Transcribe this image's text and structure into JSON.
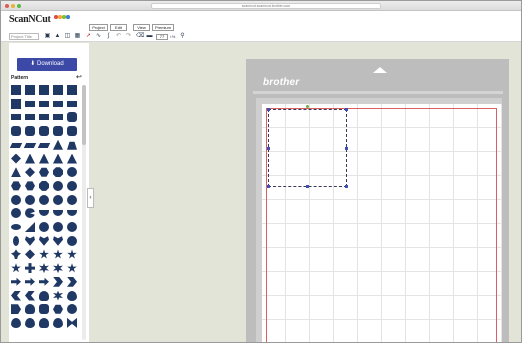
{
  "browser": {
    "url": "scanncut.scanncut.brother.com"
  },
  "header": {
    "logo_text": "ScanNCut",
    "project_placeholder": "Project Title",
    "tabs": [
      "Project",
      "Edit",
      "View",
      "Premium"
    ],
    "zoom_value": "77"
  },
  "toolbar": {
    "icons": [
      "new-project-icon",
      "save-icon",
      "open-icon",
      "cut-settings-icon",
      "select-arrow-icon",
      "curve-tool-icon",
      "bezier-tool-icon",
      "undo-icon",
      "redo-icon",
      "delete-icon",
      "fill-icon",
      "zoom-in-icon"
    ]
  },
  "sidebar": {
    "download_label": "Download",
    "pattern_label": "Pattern",
    "back_symbol": "↩",
    "collapse_symbol": "‹"
  },
  "mat": {
    "brand": "brother"
  },
  "colors": {
    "accent": "#3c49a6",
    "shape_fill": "#203864",
    "workspace_bg": "#e1e4d6",
    "mat_border": "#d96060"
  },
  "shapes": [
    "square",
    "square",
    "square",
    "square",
    "square",
    "square",
    "rect",
    "rect",
    "rect",
    "rect",
    "rect",
    "rect",
    "rect",
    "rect",
    "rounded-rect",
    "rounded-rect",
    "rounded-rect",
    "rounded-rect",
    "rounded-rect",
    "rounded-rect",
    "slant",
    "slant",
    "slant",
    "triangle",
    "trapezoid",
    "diamond",
    "triangle",
    "triangle",
    "triangle",
    "triangle",
    "triangle",
    "diamond",
    "hexagon",
    "octagon",
    "circle",
    "hexagon",
    "hexagon",
    "octagon",
    "circle",
    "circle",
    "circle",
    "circle",
    "circle",
    "circle",
    "circle",
    "circle",
    "pacman",
    "half-circle",
    "half-circle",
    "half-circle",
    "ellipse",
    "wedge",
    "circle",
    "circle",
    "circle",
    "lens",
    "heart",
    "heart",
    "heart",
    "circle",
    "club",
    "diamond",
    "star",
    "star",
    "star",
    "star",
    "cross",
    "flower",
    "flower",
    "star",
    "arrow",
    "arrow",
    "arrow",
    "chevron",
    "chevron",
    "moon",
    "moon",
    "bulb",
    "flower",
    "drop",
    "tag",
    "bulb",
    "rounded-rect",
    "hexagon",
    "circle",
    "drop",
    "drop",
    "bulb",
    "drop",
    "butterfly"
  ]
}
